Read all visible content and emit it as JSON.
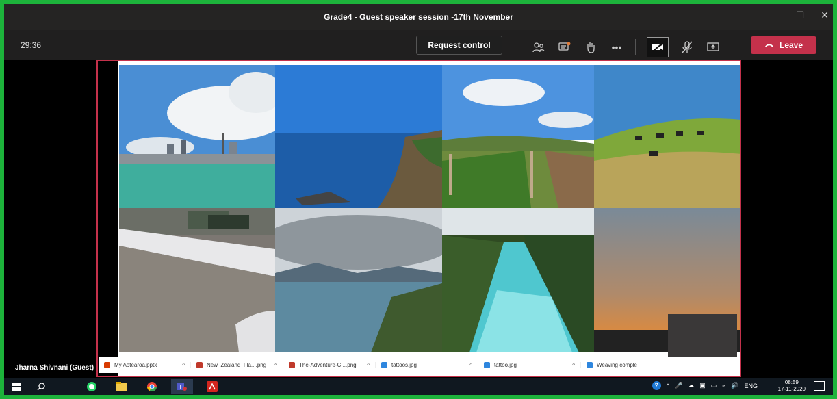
{
  "window": {
    "title": "Grade4 - Guest speaker session -17th November"
  },
  "toolbar": {
    "timer": "29:36",
    "request_control": "Request control",
    "leave": "Leave",
    "icons": [
      "participants-icon",
      "chat-icon",
      "raise-hand-icon",
      "more-options-icon",
      "camera-off-icon",
      "mic-off-icon",
      "share-screen-icon"
    ],
    "accent_leave": "#c4314b"
  },
  "presenter": {
    "name": "Jharna Shivnani (Guest)"
  },
  "downloads": [
    {
      "name": "My Aotearoa.pptx",
      "color": "#d83b01"
    },
    {
      "name": "New_Zealand_Fla....png",
      "color": "#c0392b"
    },
    {
      "name": "The-Adventure-C....png",
      "color": "#c0392b"
    },
    {
      "name": "tattoos.jpg",
      "color": "#2e86de"
    },
    {
      "name": "tattoo.jpg",
      "color": "#2e86de"
    },
    {
      "name": "Weaving comple",
      "color": "#2e86de"
    }
  ],
  "taskbar": {
    "apps": [
      "windows-start-icon",
      "search-icon",
      "whatsapp-icon",
      "file-explorer-icon",
      "chrome-icon",
      "teams-icon",
      "acrobat-icon"
    ],
    "language": "ENG",
    "time": "08:59",
    "date": "17-11-2020"
  }
}
